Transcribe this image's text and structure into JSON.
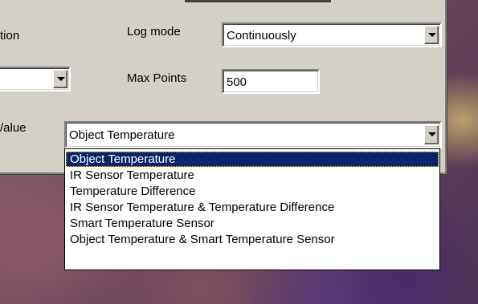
{
  "labels": {
    "option_partial": "tion",
    "log_mode": "Log mode",
    "max_points": "Max Points",
    "value_partial": "/alue"
  },
  "log_mode_select": {
    "value": "Continuously"
  },
  "left_select": {
    "value": ""
  },
  "max_points_input": {
    "value": "500"
  },
  "value_select": {
    "value": "Object Temperature"
  },
  "value_options": [
    "Object Temperature",
    "IR Sensor Temperature",
    "Temperature Difference",
    "IR Sensor Temperature & Temperature Difference",
    "Smart Temperature Sensor",
    "Object Temperature & Smart Temperature Sensor"
  ],
  "selected_option_index": 0,
  "colors": {
    "panel": "#d4d0c8",
    "selection": "#0a246a"
  }
}
